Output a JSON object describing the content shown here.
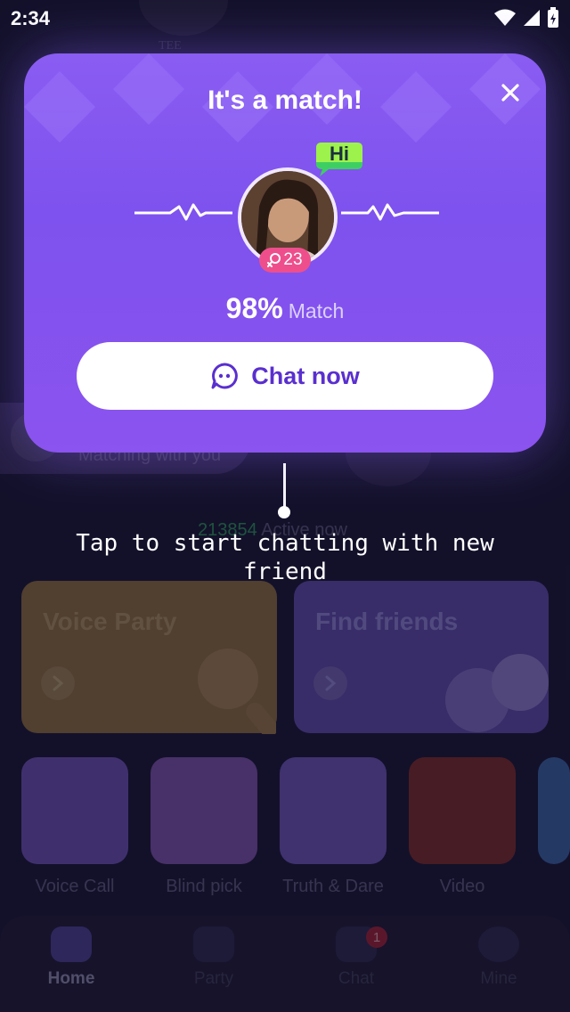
{
  "status_bar": {
    "time": "2:34"
  },
  "background": {
    "tee_text": "TEE",
    "matching_text": "Matching with you",
    "active_count": "213854",
    "active_label": "Active now",
    "cards": [
      {
        "title": "Voice Party"
      },
      {
        "title": "Find friends"
      }
    ],
    "tiles": [
      {
        "label": "Voice Call",
        "color": "#6a4fb0"
      },
      {
        "label": "Blind pick",
        "color": "#7b4fa6"
      },
      {
        "label": "Truth & Dare",
        "color": "#6a52b2"
      },
      {
        "label": "Video",
        "color": "#7a2a2a"
      }
    ],
    "tabs": [
      {
        "label": "Home"
      },
      {
        "label": "Party"
      },
      {
        "label": "Chat",
        "badge": "1"
      },
      {
        "label": "Mine"
      }
    ]
  },
  "match_modal": {
    "title": "It's a match!",
    "greeting": "Hi",
    "age": "23",
    "match_percent": "98%",
    "match_label": "Match",
    "chat_button_label": "Chat now",
    "colors": {
      "accent": "#8a5cf2",
      "badge": "#ee4f8c",
      "button_text": "#5a2fcf"
    }
  },
  "hint": {
    "text": "Tap to start chatting with new friend"
  }
}
